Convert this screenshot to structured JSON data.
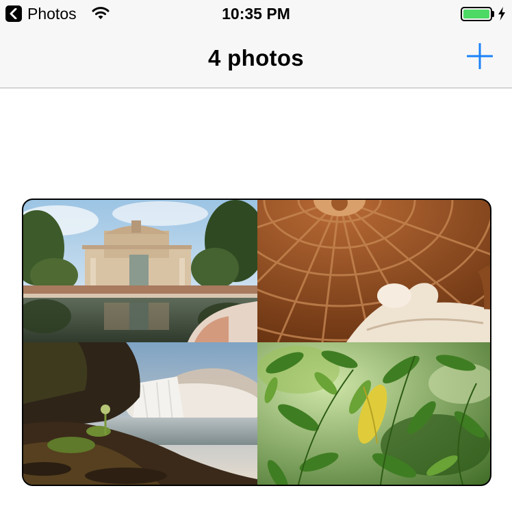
{
  "status_bar": {
    "back_app_label": "Photos",
    "time": "10:35 PM",
    "battery_color": "#4cd964"
  },
  "nav": {
    "title": "4 photos",
    "add_icon": "plus-icon",
    "accent_color": "#1a82fb"
  },
  "collage": {
    "photos": [
      {
        "subject": "pavilion-reflection"
      },
      {
        "subject": "dome-statue"
      },
      {
        "subject": "waterfall"
      },
      {
        "subject": "green-leaves"
      }
    ]
  }
}
